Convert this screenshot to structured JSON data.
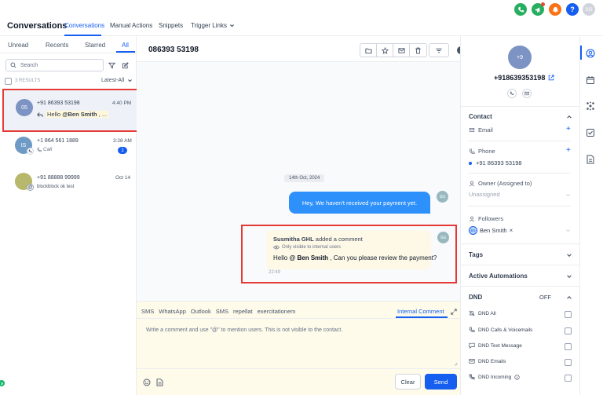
{
  "header": {
    "title": "Conversations",
    "nav": [
      {
        "label": "Conversations",
        "active": true
      },
      {
        "label": "Manual Actions"
      },
      {
        "label": "Snippets"
      },
      {
        "label": "Trigger Links"
      }
    ],
    "user_initials": "SG"
  },
  "list": {
    "tabs": [
      "Unread",
      "Recents",
      "Starred",
      "All"
    ],
    "search_placeholder": "Search",
    "results_count": "3 RESULTS",
    "sort_label": "Latest-All",
    "items": [
      {
        "initials": "05",
        "name": "+91 86393 53198",
        "time": "4:40 PM",
        "preview_prefix": "Hello ",
        "preview_mention": "@Ben Smith",
        "preview_suffix": " , ...",
        "avatar_color": "#7c93c3"
      },
      {
        "initials": "IS",
        "name": "+1 864 561 1889",
        "time": "3:28 AM",
        "preview": "Call",
        "badge": "1",
        "avatar_color": "#6e9bc5"
      },
      {
        "initials": "",
        "name": "+91 88888 99999",
        "time": "Oct 14",
        "preview": "blockblock ok test",
        "avatar_color": "#b7b86b"
      }
    ]
  },
  "chat": {
    "title": "086393 53198",
    "date_chip": "14th Oct, 2024",
    "outgoing_message": "Hey, We haven't received your payment yet.",
    "outgoing_avatar": "SG",
    "comment": {
      "author": "Susmitha GHL",
      "action": " added a comment",
      "visibility": "Only visible to internal users",
      "text_prefix": "Hello ",
      "mention": "@ Ben Smith",
      "text_suffix": "  , Can you please review the payment?",
      "time": "22:49",
      "avatar": "SG"
    },
    "composer": {
      "channels": [
        "SMS",
        "WhatsApp",
        "Outlook",
        "SMS",
        "repellat",
        "exercitationem"
      ],
      "active_channel": "Internal Comment",
      "placeholder": "Write a comment and use \"@\" to mention users. This is not visible to the contact.",
      "clear_label": "Clear",
      "send_label": "Send"
    }
  },
  "contact": {
    "avatar_initials": "+9",
    "phone_title": "+918639353198",
    "contact_heading": "Contact",
    "email_label": "Email",
    "phone_label": "Phone",
    "phone_value": "+91 86393 53198",
    "owner_label": "Owner (Assigned to)",
    "owner_value": "Unassigned",
    "followers_label": "Followers",
    "follower": {
      "initials": "BS",
      "name": "Ben Smith"
    },
    "tags_heading": "Tags",
    "automations_heading": "Active Automations",
    "dnd_heading": "DND",
    "dnd_state": "OFF",
    "dnd_items": [
      "DND All",
      "DND Calls & Voicemails",
      "DND Text Message",
      "DND Emails",
      "DND Incoming"
    ]
  },
  "colors": {
    "accent": "#155eef",
    "comment_bg": "#fef9e7",
    "outgoing_bg": "#2e90fa",
    "composer_bg": "#fefbeb",
    "highlight": "#e53935"
  }
}
